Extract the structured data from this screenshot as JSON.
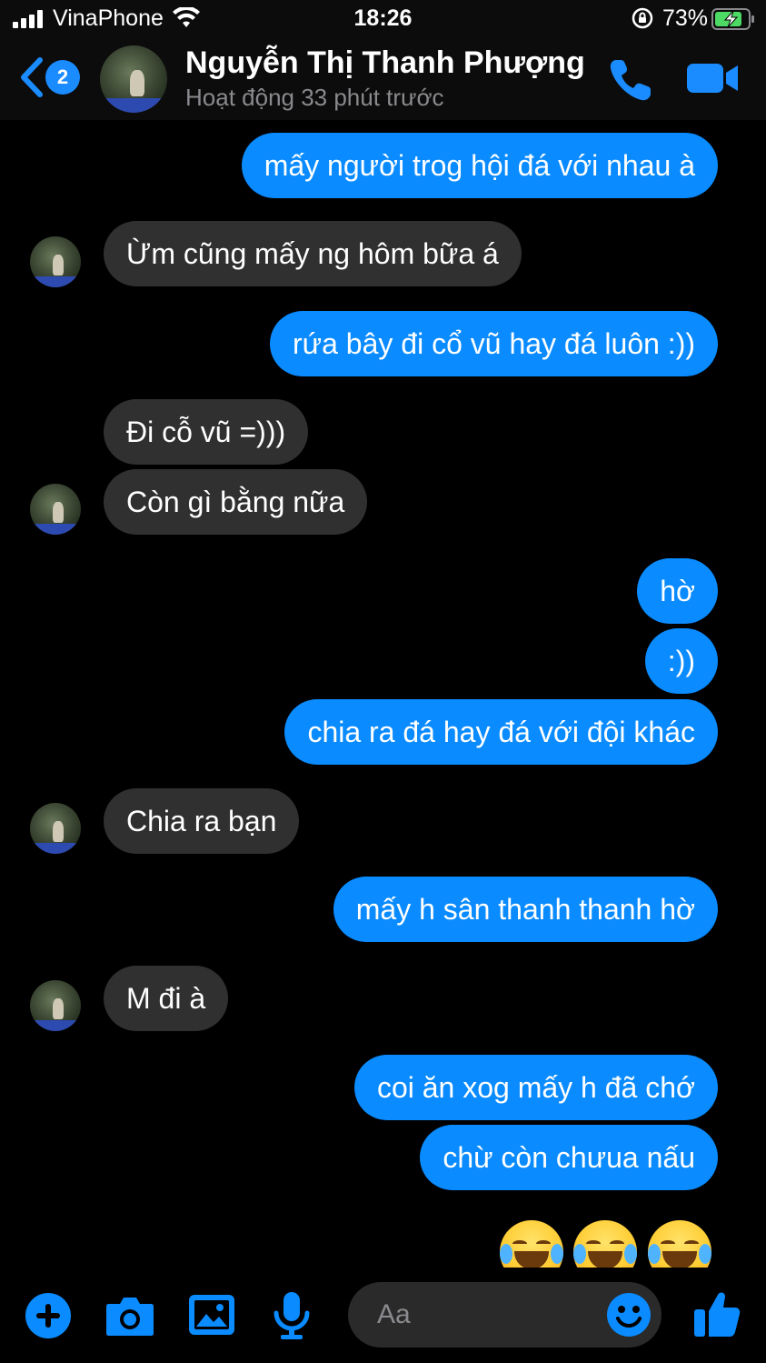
{
  "status_bar": {
    "carrier": "VinaPhone",
    "time": "18:26",
    "battery": "73%"
  },
  "header": {
    "back_badge": "2",
    "contact_name": "Nguyễn Thị Thanh Phượng",
    "contact_status": "Hoạt động 33 phút trước"
  },
  "messages": [
    {
      "side": "me",
      "text": "mấy người trog hội đá với nhau à"
    },
    {
      "side": "them",
      "text": "Ừm cũng mấy ng hôm bữa á"
    },
    {
      "side": "me",
      "text": "rứa bây đi cổ vũ hay đá luôn :))"
    },
    {
      "side": "them",
      "text": "Đi cỗ vũ =)))"
    },
    {
      "side": "them",
      "text": "Còn gì bằng nữa"
    },
    {
      "side": "me",
      "text": "hờ"
    },
    {
      "side": "me",
      "text": ":))"
    },
    {
      "side": "me",
      "text": "chia ra đá hay đá với đội khác"
    },
    {
      "side": "them",
      "text": "Chia ra bạn"
    },
    {
      "side": "me",
      "text": "mấy h sân thanh thanh hờ"
    },
    {
      "side": "them",
      "text": "M đi à"
    },
    {
      "side": "me",
      "text": "coi ăn xog mấy h đã chớ"
    },
    {
      "side": "me",
      "text": "chừ còn chưua nấu"
    }
  ],
  "emoji_reaction": "face-with-tears-of-joy x3",
  "composer": {
    "placeholder": "Aa"
  },
  "colors": {
    "accent": "#0a8bff",
    "incoming_bubble": "#303030",
    "background": "#000000"
  }
}
